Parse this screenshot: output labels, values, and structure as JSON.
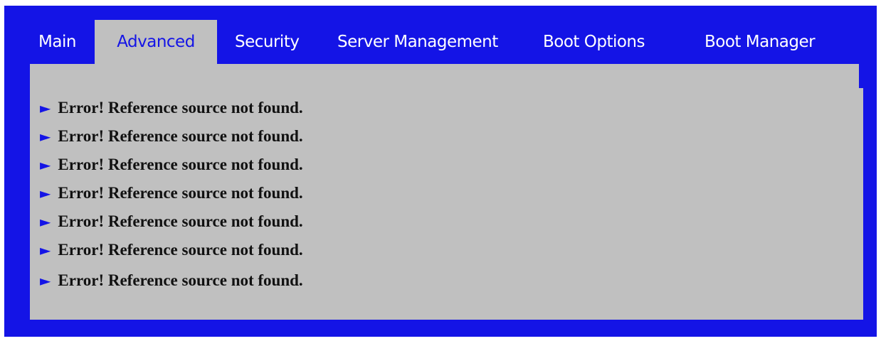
{
  "tabs": [
    {
      "label": "Main",
      "active": false
    },
    {
      "label": "Advanced",
      "active": true
    },
    {
      "label": "Security",
      "active": false
    },
    {
      "label": "Server Management",
      "active": false
    },
    {
      "label": "Boot Options",
      "active": false
    },
    {
      "label": "Boot Manager",
      "active": false
    }
  ],
  "menu": {
    "arrow_icon": "right-pointer",
    "items": [
      {
        "label": "Error! Reference source not found."
      },
      {
        "label": "Error! Reference source not found."
      },
      {
        "label": "Error! Reference source not found."
      },
      {
        "label": "Error! Reference source not found."
      },
      {
        "label": "Error! Reference source not found."
      },
      {
        "label": "Error! Reference source not found."
      },
      {
        "label": "Error! Reference source not found."
      }
    ]
  },
  "colors": {
    "frame_blue": "#1414e6",
    "panel_gray": "#c0c0c0",
    "tab_text": "#ffffff",
    "active_tab_text": "#1414e6",
    "item_text": "#111111"
  }
}
